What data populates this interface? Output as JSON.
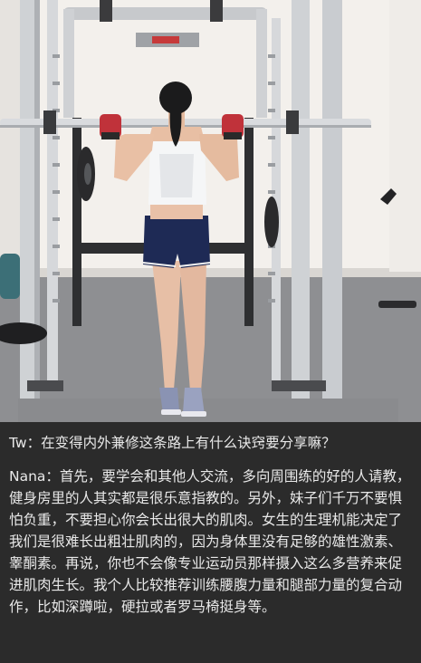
{
  "question": "Tw：在变得内外兼修这条路上有什么诀窍要分享嘛？",
  "answer": "Nana：首先，要学会和其他人交流，多向周围练的好的人请教，健身房里的人其实都是很乐意指教的。另外，妹子们千万不要惧怕负重，不要担心你会长出很大的肌肉。女生的生理机能决定了我们是很难长出粗壮肌肉的，因为身体里没有足够的雄性激素、睾酮素。再说，你也不会像专业运动员那样摄入这么多营养来促进肌肉生长。我个人比较推荐训练腰腹力量和腿部力量的复合动作，比如深蹲啦，硬拉或者罗马椅挺身等。",
  "colors": {
    "background": "#2b2b2b",
    "text": "#e9e9e9",
    "shorts": "#1e2a55",
    "gloves": "#c0323a"
  }
}
